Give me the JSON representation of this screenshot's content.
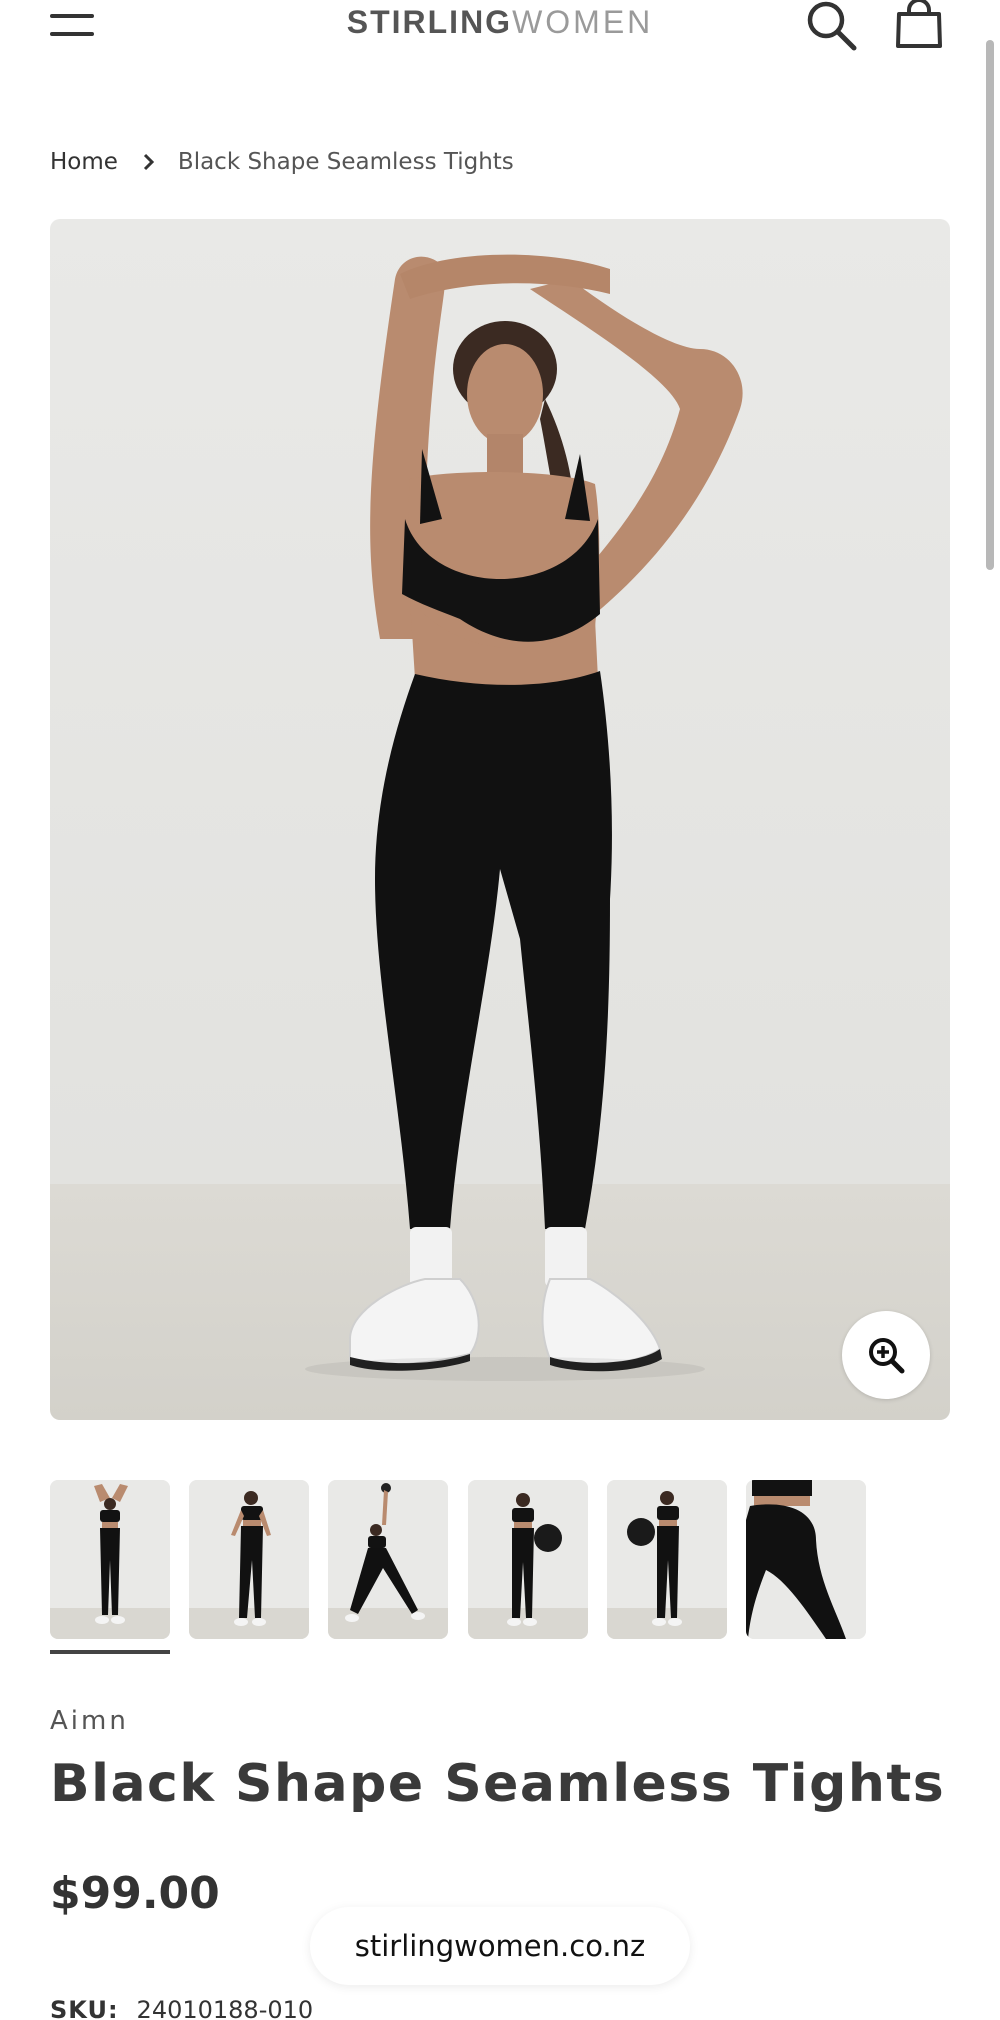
{
  "header": {
    "logo_bold": "STIRLING",
    "logo_light": "WOMEN",
    "menu_icon": "hamburger-icon",
    "search_icon": "search-icon",
    "cart_icon": "shopping-bag-icon"
  },
  "breadcrumb": {
    "home": "Home",
    "current": "Black Shape Seamless Tights"
  },
  "gallery": {
    "main_image_alt": "Black Shape Seamless Tights",
    "thumbnail_count": 6,
    "active_thumbnail": 1
  },
  "product": {
    "vendor": "Aimn",
    "title": "Black Shape Seamless Tights",
    "price": "$99.00",
    "sku_label": "SKU:",
    "sku_value": "24010188-010"
  },
  "browser": {
    "url": "stirlingwomen.co.nz"
  },
  "colors": {
    "text": "#333333",
    "background": "#ffffff",
    "photo_wall": "#ebebe9",
    "photo_floor": "#d9d7d1",
    "garment": "#111111"
  }
}
